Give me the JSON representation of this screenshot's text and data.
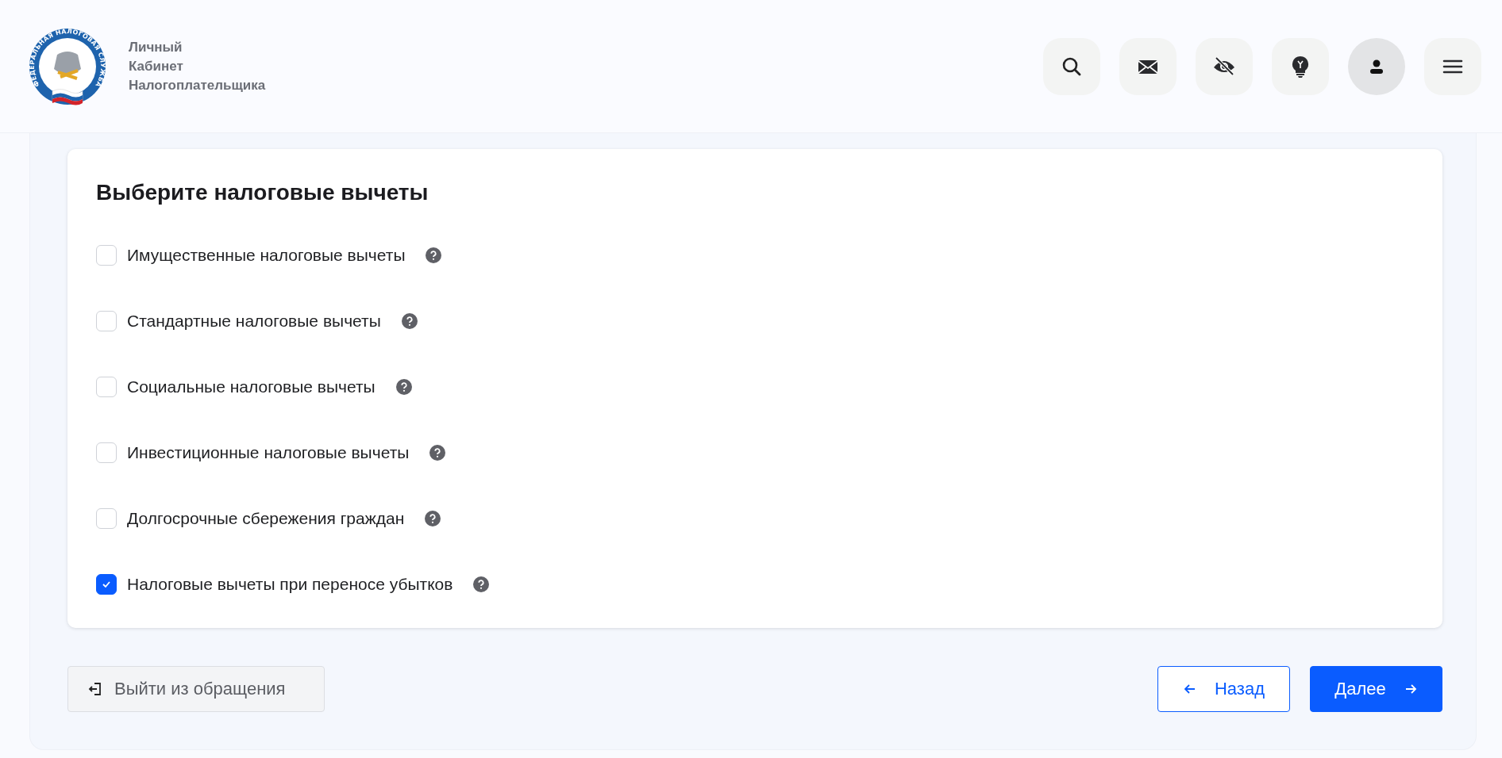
{
  "header": {
    "logo_text": "ФЕДЕРАЛЬНАЯ НАЛОГОВАЯ СЛУЖБА",
    "title_lines": [
      "Личный",
      "Кабинет",
      "Налогоплательщика"
    ],
    "icons": [
      {
        "kind": "search"
      },
      {
        "kind": "mail"
      },
      {
        "kind": "eye-off"
      },
      {
        "kind": "bulb"
      },
      {
        "kind": "user"
      },
      {
        "kind": "menu"
      }
    ]
  },
  "card": {
    "title": "Выберите налоговые вычеты",
    "options": [
      {
        "label": "Имущественные налоговые вычеты",
        "checked": false
      },
      {
        "label": "Стандартные налоговые вычеты",
        "checked": false
      },
      {
        "label": "Социальные налоговые вычеты",
        "checked": false
      },
      {
        "label": "Инвестиционные налоговые вычеты",
        "checked": false
      },
      {
        "label": "Долгосрочные сбережения граждан",
        "checked": false
      },
      {
        "label": "Налоговые вычеты при переносе убытков",
        "checked": true
      }
    ]
  },
  "footer": {
    "exit_button": "Выйти из обращения",
    "back_button": "Назад",
    "next_button": "Далее"
  }
}
